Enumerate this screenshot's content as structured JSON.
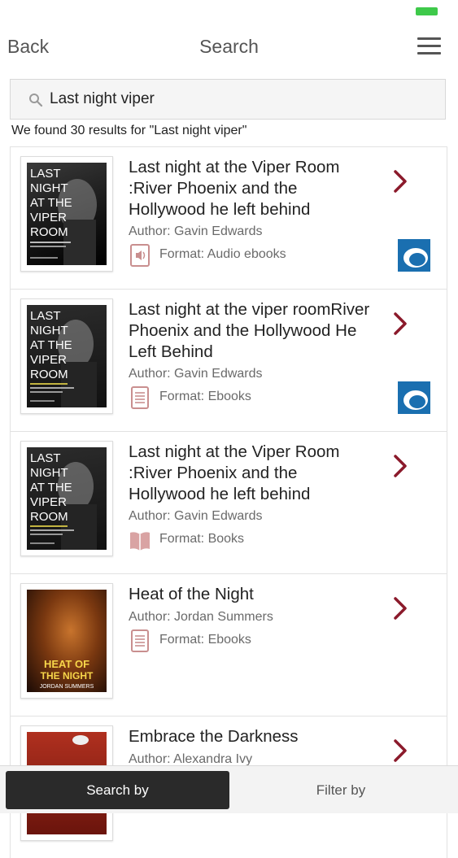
{
  "nav": {
    "back_label": "Back",
    "title": "Search"
  },
  "search": {
    "query": "Last night viper"
  },
  "result_summary": "We found 30 results for \"Last night viper\"",
  "results": [
    {
      "title": "Last night at the Viper Room :River Phoenix and the Hollywood he left behind",
      "author": "Author: Gavin Edwards",
      "format": "Format: Audio ebooks",
      "format_icon": "audio-icon",
      "provider_logo": true,
      "cover": {
        "line1": "LAST",
        "line2": "NIGHT",
        "line3": "AT THE",
        "line4": "VIPER",
        "line5": "ROOM"
      }
    },
    {
      "title": "Last night at the viper roomRiver Phoenix and the Hollywood He Left Behind",
      "author": "Author: Gavin Edwards",
      "format": "Format: Ebooks",
      "format_icon": "ebook-icon",
      "provider_logo": true,
      "cover": {
        "line1": "LAST",
        "line2": "NIGHT",
        "line3": "AT THE",
        "line4": "VIPER",
        "line5": "ROOM"
      }
    },
    {
      "title": "Last night at the Viper Room :River Phoenix and the Hollywood he left behind",
      "author": "Author: Gavin Edwards",
      "format": "Format: Books",
      "format_icon": "book-icon",
      "provider_logo": false,
      "cover": {
        "line1": "LAST",
        "line2": "NIGHT",
        "line3": "AT THE",
        "line4": "VIPER",
        "line5": "ROOM"
      }
    },
    {
      "title": "Heat of the Night",
      "author": "Author: Jordan Summers",
      "format": "Format: Ebooks",
      "format_icon": "ebook-icon",
      "provider_logo": false,
      "cover": {
        "line1": "HEAT OF",
        "line2": "THE NIGHT",
        "line3": "JORDAN SUMMERS"
      }
    },
    {
      "title": "Embrace the Darkness",
      "author": "Author: Alexandra Ivy",
      "format": "",
      "format_icon": "",
      "provider_logo": false,
      "cover": {}
    }
  ],
  "bottom_tabs": {
    "search_by": "Search by",
    "filter_by": "Filter by"
  },
  "colors": {
    "accent": "#8b1a2b",
    "battery": "#3ec94a",
    "provider_blue": "#1a6fb0"
  }
}
